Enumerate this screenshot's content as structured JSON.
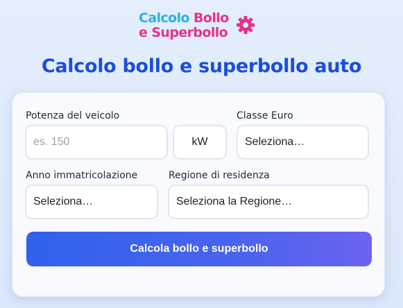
{
  "logo": {
    "line1_a": "Calcolo",
    "line1_b": "Bollo",
    "line2_a": "e",
    "line2_b": "Superbollo",
    "icon": "gear-icon"
  },
  "title": "Calcolo bollo e superbollo auto",
  "form": {
    "power_label": "Potenza del veicolo",
    "power_placeholder": "es. 150",
    "power_unit": "kW",
    "euro_label": "Classe Euro",
    "euro_value": "Seleziona…",
    "year_label": "Anno immatricolazione",
    "year_value": "Seleziona…",
    "region_label": "Regione di residenza",
    "region_value": "Seleziona la Regione…",
    "submit_label": "Calcola bollo e superbollo"
  },
  "colors": {
    "accent": "#1d4ed8",
    "logo_blue": "#2bb0e8",
    "logo_pink": "#e8318a",
    "button_start": "#2f62ec",
    "button_end": "#6b63f0"
  }
}
